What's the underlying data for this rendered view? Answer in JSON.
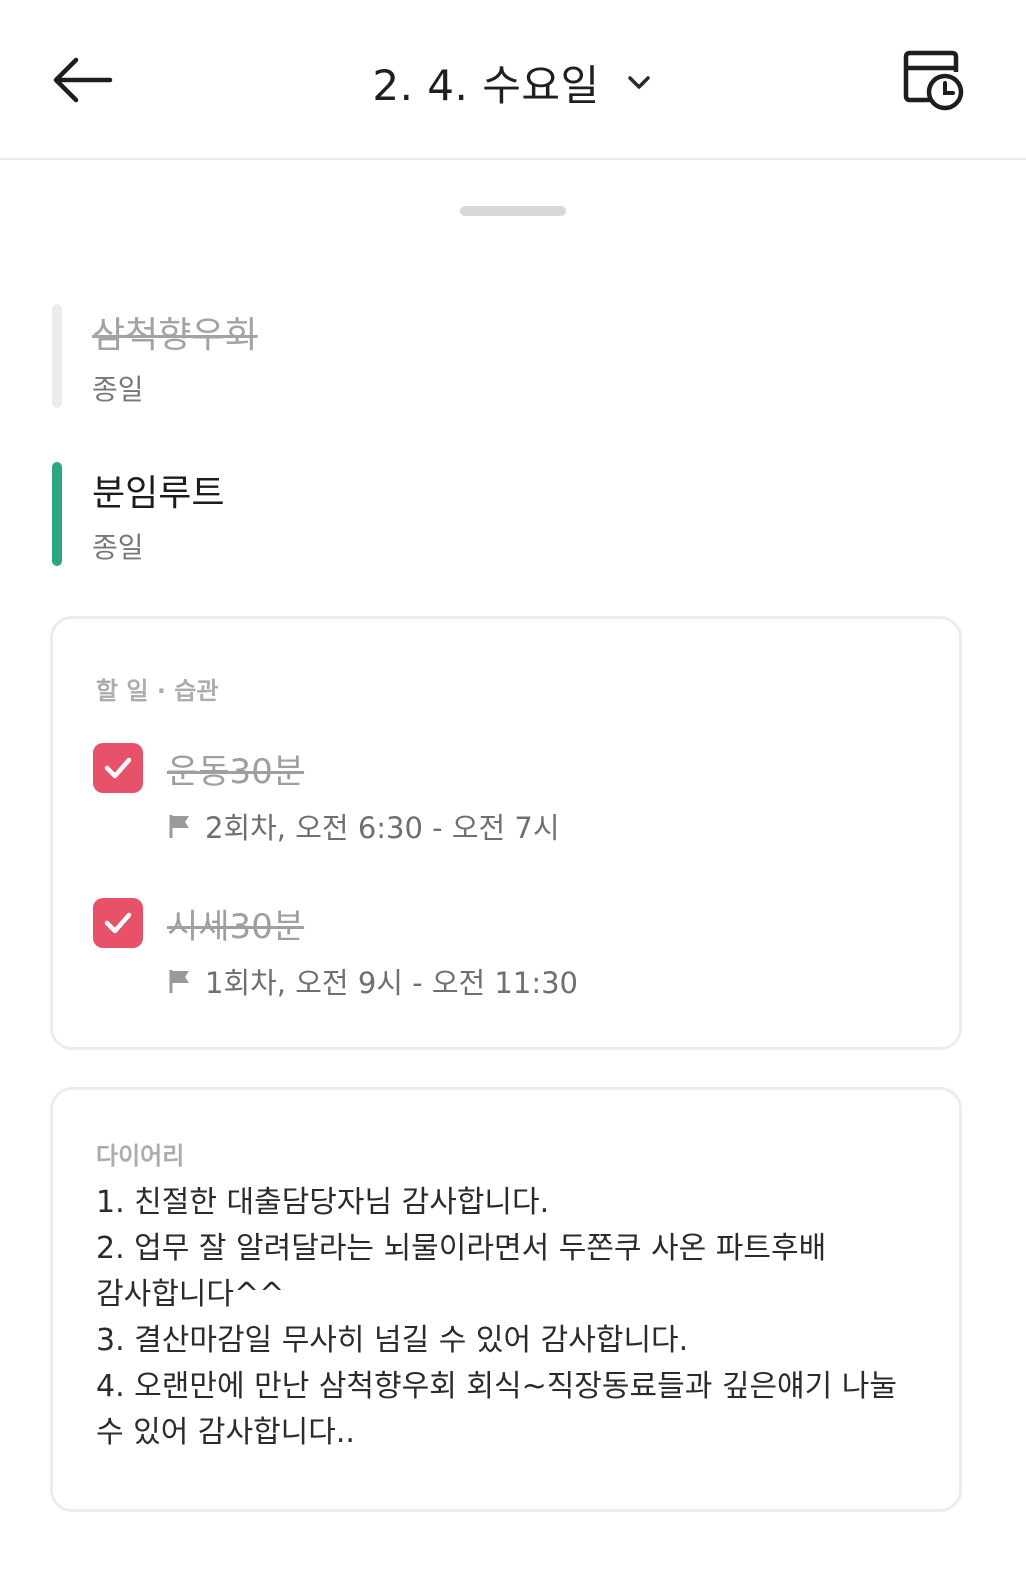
{
  "header": {
    "title": "2. 4. 수요일",
    "back_icon": "arrow-left-icon",
    "dropdown_icon": "chevron-down-icon",
    "calendar_icon": "calendar-clock-icon"
  },
  "events": [
    {
      "name": "삼척향우회",
      "sub": "종일",
      "completed": true,
      "color": "#ececec"
    },
    {
      "name": "분임루트",
      "sub": "종일",
      "completed": false,
      "color": "#2aa77f"
    }
  ],
  "tasks_section": {
    "label": "할 일 · 습관",
    "items": [
      {
        "name": "운동30분",
        "meta": "2회차, 오전 6:30 - 오전 7시",
        "checked": true
      },
      {
        "name": "시세30분",
        "meta": "1회차, 오전 9시 - 오전 11:30",
        "checked": true
      }
    ]
  },
  "diary": {
    "label": "다이어리",
    "lines": [
      "1. 친절한 대출담당자님 감사합니다.",
      "2. 업무 잘 알려달라는 뇌물이라면서 두쫀쿠 사온 파트후배",
      "감사합니다^^",
      "3. 결산마감일 무사히 넘길 수 있어 감사합니다.",
      "4. 오랜만에 만난 삼척향우회 회식~직장동료들과 깊은얘기 나눌",
      "수 있어 감사합니다.."
    ]
  },
  "colors": {
    "accent_check": "#e8516a",
    "routine_green": "#2aa77f"
  }
}
